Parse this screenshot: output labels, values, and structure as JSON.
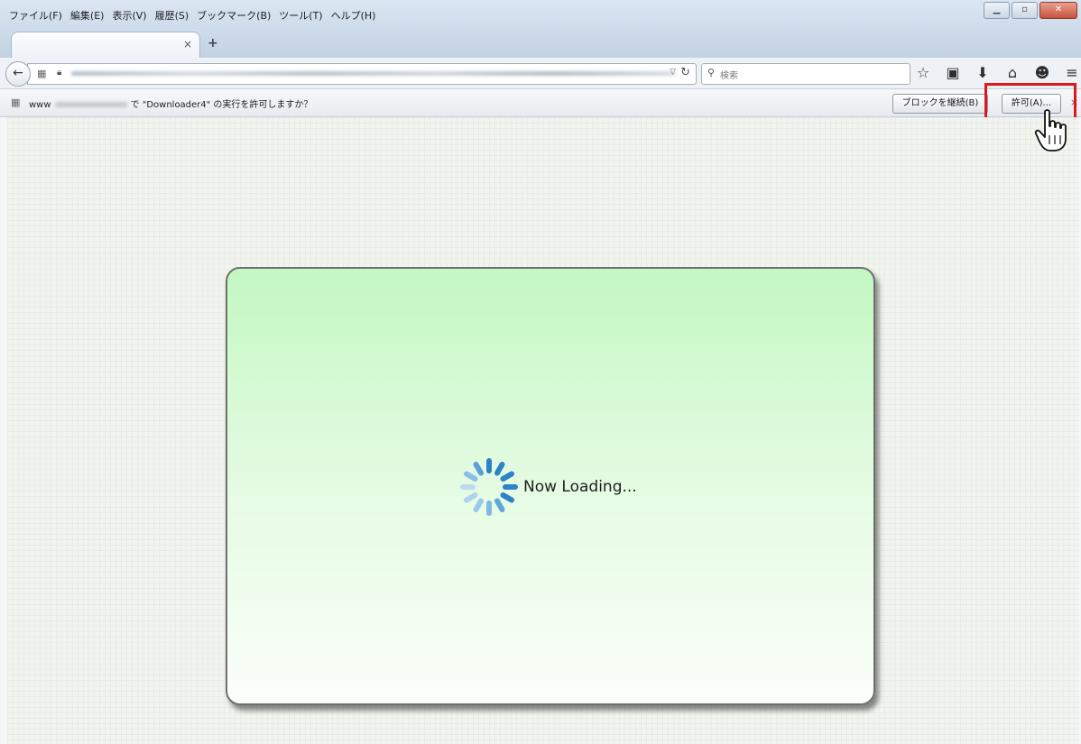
{
  "menubar": {
    "items": [
      "ファイル(F)",
      "編集(E)",
      "表示(V)",
      "履歴(S)",
      "ブックマーク(B)",
      "ツール(T)",
      "ヘルプ(H)"
    ],
    "minimize_icon": "minimize-icon",
    "maximize_icon": "maximize-icon",
    "close_icon": "close-icon"
  },
  "tabs": {
    "close_glyph": "×",
    "new_tab_glyph": "+"
  },
  "navbar": {
    "back_glyph": "←",
    "reload_glyph": "↻",
    "dropmarker_glyph": "▽",
    "search_placeholder": "検索",
    "icons": [
      {
        "name": "bookmark-star-icon",
        "glyph": "☆"
      },
      {
        "name": "bookmarks-list-icon",
        "glyph": "▣"
      },
      {
        "name": "download-icon",
        "glyph": "⬇"
      },
      {
        "name": "home-icon",
        "glyph": "⌂"
      },
      {
        "name": "chat-icon",
        "glyph": "☻"
      },
      {
        "name": "menu-icon",
        "glyph": "≡"
      }
    ]
  },
  "notification": {
    "prefix": "www",
    "message": "で \"Downloader4\" の実行を許可しますか？",
    "block_label": "ブロックを継続(B)",
    "allow_label": "許可(A)...",
    "close_glyph": "×"
  },
  "content": {
    "loading_text": "Now Loading..."
  },
  "colors": {
    "highlight": "#e0181b",
    "card_top": "#c2f8c2",
    "spinner": "#3f8fd2"
  }
}
